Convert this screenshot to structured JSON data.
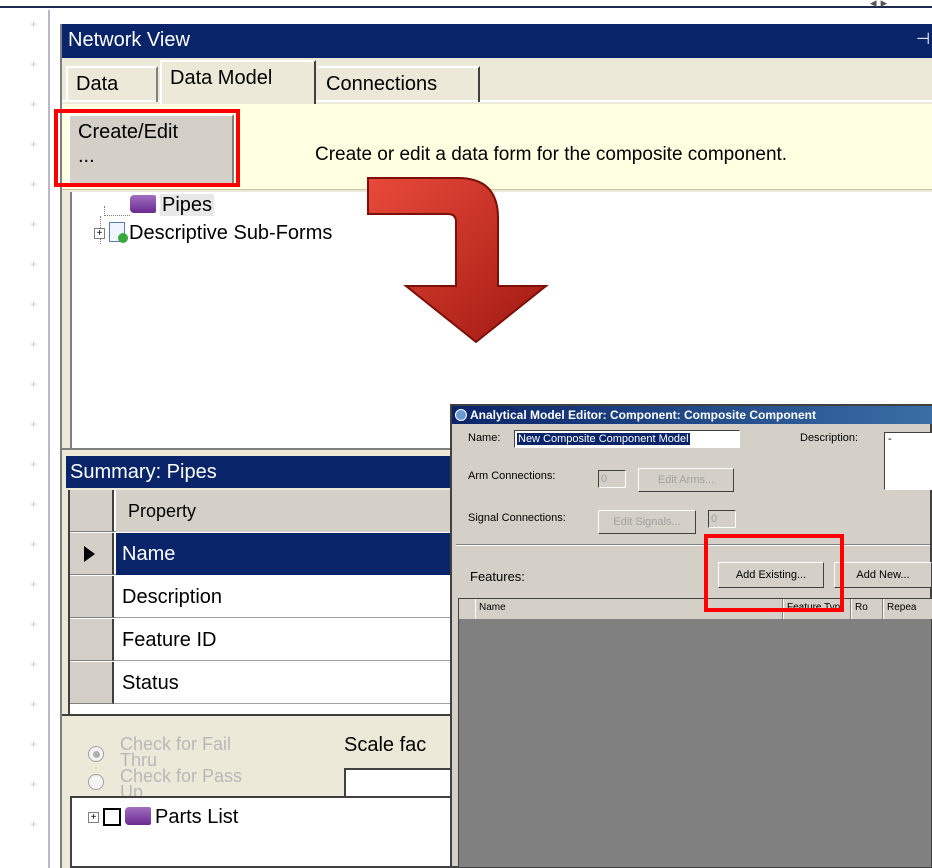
{
  "network_view": {
    "title": "Network View",
    "pin_glyph": "⊣",
    "tabs": [
      {
        "label": "Data"
      },
      {
        "label": "Data Model"
      },
      {
        "label": "Connections"
      }
    ],
    "create_button": {
      "line1": "Create/Edit",
      "line2": "..."
    },
    "info_text": "Create or edit a data form for the composite component.",
    "tree": {
      "root": "Pipes",
      "child": "Descriptive Sub-Forms"
    }
  },
  "summary": {
    "title": "Summary: Pipes",
    "header": "Property",
    "rows": [
      "Name",
      "Description",
      "Feature ID",
      "Status"
    ]
  },
  "options": {
    "radio1": "Check for Fail Thru",
    "radio2": "Check for Pass Up",
    "scale_label": "Scale fac"
  },
  "parts_list": {
    "label": "Parts List"
  },
  "editor": {
    "title": "Analytical Model Editor: Component: Composite Component",
    "name_label": "Name:",
    "name_value": "New Composite Component Model",
    "description_label": "Description:",
    "description_value": "-",
    "arm_label": "Arm Connections:",
    "arm_value": "0",
    "edit_arms": "Edit Arms...",
    "signal_label": "Signal Connections:",
    "edit_signals": "Edit Signals...",
    "signal_value": "0",
    "features_label": "Features:",
    "add_existing": "Add Existing...",
    "add_new": "Add New...",
    "columns": [
      "Name",
      "Feature Typ",
      "Ro",
      "Repea"
    ]
  },
  "colors": {
    "titlebar": "#0a246a",
    "highlight": "#ff0000",
    "infobar": "#ffffe1",
    "arrow": "#d42a1e"
  }
}
